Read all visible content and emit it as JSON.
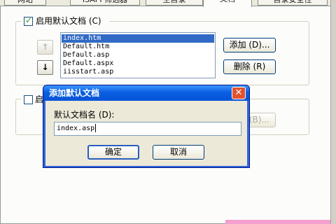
{
  "tabs": [
    {
      "label": "网站"
    },
    {
      "label": "ISAPI 筛选器"
    },
    {
      "label": "主目录"
    },
    {
      "label": "文档"
    },
    {
      "label": "目录安全性"
    }
  ],
  "default_doc": {
    "enable_label": "启用默认文档 (C)",
    "enabled": true,
    "files": [
      "index.htm",
      "Default.htm",
      "Default.asp",
      "Default.aspx",
      "iisstart.asp"
    ],
    "selected_file": "index.htm",
    "add_button": "添加 (D)...",
    "remove_button": "删除 (R)",
    "move_up_icon": "arrow-up-icon",
    "move_down_icon": "arrow-down-icon"
  },
  "footer_section": {
    "checkbox_label": "启",
    "browse_button": "浏览 (B)..."
  },
  "dialog": {
    "title": "添加默认文档",
    "field_label": "默认文档名 (D):",
    "field_value": "index.asp",
    "ok_button": "确定",
    "cancel_button": "取消",
    "close_icon": "close-icon"
  },
  "colors": {
    "title_bar": "#0553d8",
    "selection": "#316ac5",
    "close_button": "#e2522d"
  }
}
